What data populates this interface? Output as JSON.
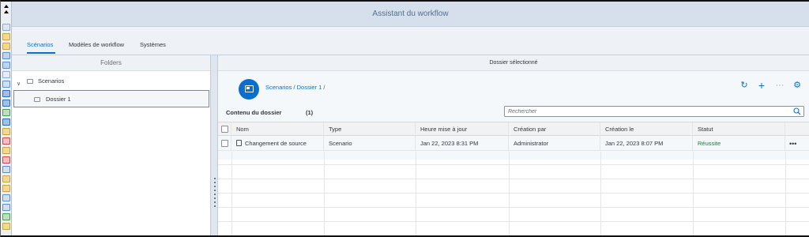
{
  "app": {
    "title": "Assistant du workflow"
  },
  "tabs": [
    {
      "label": "Scénarios",
      "active": true
    },
    {
      "label": "Modèles de workflow",
      "active": false
    },
    {
      "label": "Systèmes",
      "active": false
    }
  ],
  "folders": {
    "header": "Folders",
    "tree": [
      {
        "label": "Scenarios",
        "expanded": true
      },
      {
        "label": "Dossier 1",
        "selected": true
      }
    ]
  },
  "details": {
    "header": "Dossier sélectionné",
    "breadcrumb": {
      "root": "Scenarios",
      "sep1": " / ",
      "current": "Dossier 1",
      "sep2": " /"
    },
    "toolbar": {
      "refresh": "↻",
      "add": "+",
      "more": "···",
      "settings": "⚙"
    },
    "list_title": "Contenu du dossier",
    "list_count": "(1)",
    "search_placeholder": "Rechercher",
    "columns": [
      "Nom",
      "Type",
      "Heure mise à jour",
      "Création par",
      "Création le",
      "Statut"
    ],
    "rows": [
      {
        "name": "Changement de source",
        "type": "Scenario",
        "updated": "Jan 22, 2023 8:31 PM",
        "created_by": "Administrator",
        "created_on": "Jan 22, 2023 8:07 PM",
        "status": "Réussite",
        "more": "•••"
      }
    ]
  },
  "colors": {
    "accent": "#0a6ed1",
    "success": "#107e3e",
    "shell": "#d5e0ec"
  }
}
